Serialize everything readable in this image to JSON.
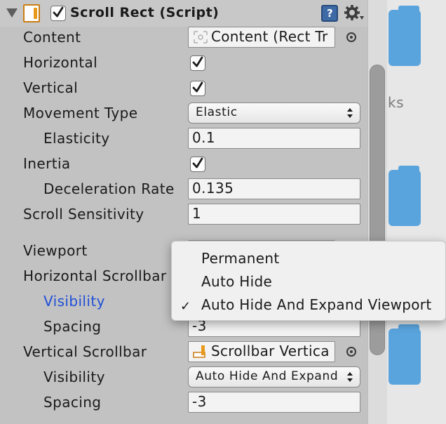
{
  "component": {
    "title": "Scroll Rect (Script)",
    "enabled": true
  },
  "fields": {
    "content": {
      "label": "Content",
      "value": "Content (Rect Tr"
    },
    "horizontal": {
      "label": "Horizontal",
      "checked": true
    },
    "vertical": {
      "label": "Vertical",
      "checked": true
    },
    "movement_type": {
      "label": "Movement Type",
      "value": "Elastic"
    },
    "elasticity": {
      "label": "Elasticity",
      "value": "0.1"
    },
    "inertia": {
      "label": "Inertia",
      "checked": true
    },
    "deceleration_rate": {
      "label": "Deceleration Rate",
      "value": "0.135"
    },
    "scroll_sensitivity": {
      "label": "Scroll Sensitivity",
      "value": "1"
    },
    "viewport": {
      "label": "Viewport"
    },
    "horizontal_scrollbar": {
      "label": "Horizontal Scrollbar"
    },
    "h_visibility": {
      "label": "Visibility"
    },
    "h_spacing": {
      "label": "Spacing",
      "value": "-3"
    },
    "vertical_scrollbar": {
      "label": "Vertical Scrollbar",
      "value": "Scrollbar Vertica"
    },
    "v_visibility": {
      "label": "Visibility",
      "value": "Auto Hide And Expand"
    },
    "v_spacing": {
      "label": "Spacing",
      "value": "-3"
    }
  },
  "visibility_menu": {
    "options": [
      "Permanent",
      "Auto Hide",
      "Auto Hide And Expand Viewport"
    ],
    "selected": "Auto Hide And Expand Viewport",
    "check_glyph": "✓"
  },
  "right_panel": {
    "partial_text": "ks"
  },
  "colors": {
    "panel_bg": "#c2c2c2",
    "accent_blue": "#1f4fd8",
    "folder_blue": "#5aa4de"
  }
}
